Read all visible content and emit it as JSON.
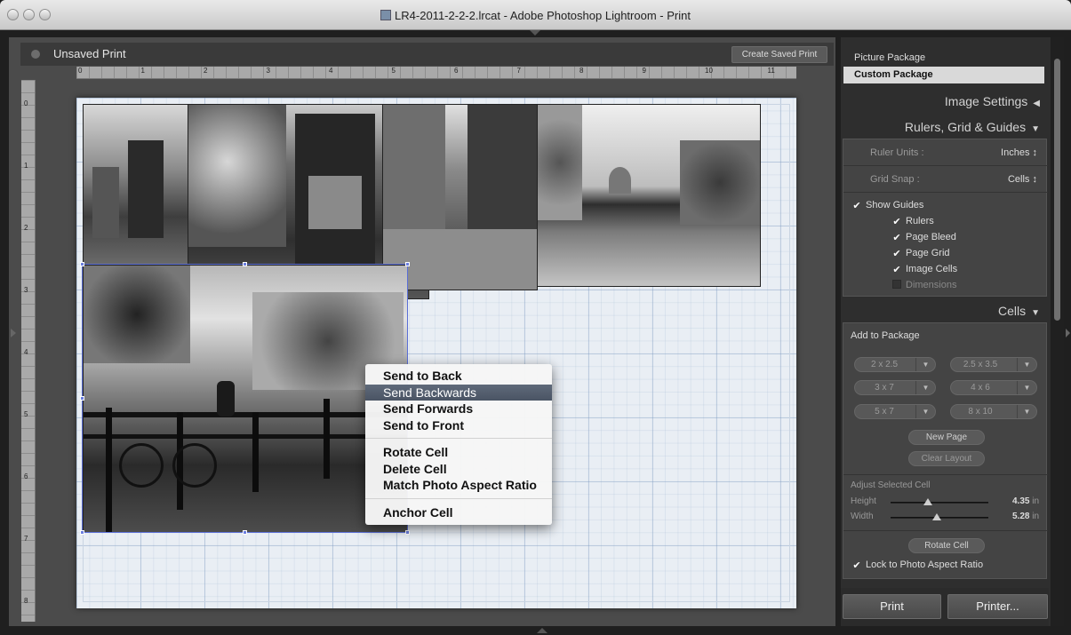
{
  "window": {
    "title": "LR4-2011-2-2-2.lrcat - Adobe Photoshop Lightroom - Print"
  },
  "doc": {
    "title": "Unsaved Print",
    "save_button": "Create Saved Print"
  },
  "ruler": {
    "h": [
      "0",
      "1",
      "2",
      "3",
      "4",
      "5",
      "6",
      "7",
      "8",
      "9",
      "10",
      "11"
    ],
    "v": [
      "0",
      "1",
      "2",
      "3",
      "4",
      "5",
      "6",
      "7",
      "8"
    ]
  },
  "context_menu": {
    "items_a": [
      "Send to Back",
      "Send Backwards",
      "Send Forwards",
      "Send to Front"
    ],
    "items_b": [
      "Rotate Cell",
      "Delete Cell",
      "Match Photo Aspect Ratio"
    ],
    "items_c": [
      "Anchor Cell"
    ],
    "highlighted": "Send Backwards"
  },
  "templates": {
    "items": [
      "Picture Package",
      "Custom Package"
    ],
    "selected": "Custom Package"
  },
  "panels": {
    "image_settings": "Image Settings",
    "rulers_grid": "Rulers, Grid & Guides",
    "cells": "Cells"
  },
  "rulers_grid": {
    "ruler_units_label": "Ruler Units :",
    "ruler_units_value": "Inches ↕",
    "grid_snap_label": "Grid Snap :",
    "grid_snap_value": "Cells ↕",
    "show_guides": "Show Guides",
    "rulers": "Rulers",
    "page_bleed": "Page Bleed",
    "page_grid": "Page Grid",
    "image_cells": "Image Cells",
    "dimensions": "Dimensions"
  },
  "cells": {
    "add_to_package": "Add to Package",
    "sizes": [
      "2 x 2.5",
      "2.5 x 3.5",
      "3 x 7",
      "4 x 6",
      "5 x 7",
      "8 x 10"
    ],
    "new_page": "New Page",
    "clear_layout": "Clear Layout",
    "adjust_selected": "Adjust Selected Cell",
    "height_label": "Height",
    "height_value": "4.35",
    "height_unit": "in",
    "height_frac": 0.38,
    "width_label": "Width",
    "width_value": "5.28",
    "width_unit": "in",
    "width_frac": 0.47,
    "rotate_cell": "Rotate Cell",
    "lock_aspect": "Lock to Photo Aspect Ratio"
  },
  "footer": {
    "print": "Print",
    "printer": "Printer..."
  },
  "colors": {
    "selection": "#5b6fd6",
    "highlight": "#4f5a6a",
    "panel_bg": "#444444"
  },
  "icons": [
    "close-light-icon",
    "minimize-light-icon",
    "zoom-light-icon",
    "catalog-doc-icon",
    "collapse-triangle-icon",
    "checkmark-icon",
    "dropdown-arrow-icon",
    "slider-knob-icon"
  ]
}
